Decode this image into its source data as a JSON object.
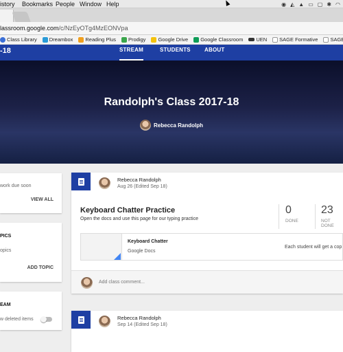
{
  "menubar": {
    "items": [
      "istory",
      "Bookmarks",
      "People",
      "Window",
      "Help"
    ]
  },
  "browser": {
    "url_host": "lassroom.google.com",
    "url_path": "/c/NzEyOTg4MzEONVpa"
  },
  "bookmarks": [
    {
      "label": "Class Library",
      "color": "#3b6fd6"
    },
    {
      "label": "Dreambox",
      "color": "#2a9bd8"
    },
    {
      "label": "Reading Plus",
      "color": "#f0a020"
    },
    {
      "label": "Prodigy",
      "color": "#3aa64b"
    },
    {
      "label": "Google Drive",
      "color": "#f4c20d"
    },
    {
      "label": "Google Classroom",
      "color": "#0f9d58"
    },
    {
      "label": "UEN",
      "color": "#333333"
    },
    {
      "label": "SAGE Formative",
      "color": "#999999"
    },
    {
      "label": "SAGE Su",
      "color": "#999999"
    }
  ],
  "classnav": {
    "class_abbrev": "-18",
    "tabs": [
      {
        "label": "STREAM",
        "active": true
      },
      {
        "label": "STUDENTS",
        "active": false
      },
      {
        "label": "ABOUT",
        "active": false
      }
    ]
  },
  "banner": {
    "title": "Randolph's Class 2017-18",
    "teacher": "Rebecca Randolph"
  },
  "left": {
    "upcoming_text": "work due soon",
    "view_all": "VIEW ALL",
    "topics_heading": "PICS",
    "topics_text": "opics",
    "add_topic": "ADD TOPIC",
    "stream_heading": "EAM",
    "show_deleted": "w deleted items"
  },
  "posts": [
    {
      "author": "Rebecca Randolph",
      "date": "Aug 26 (Edited Sep 18)",
      "title": "Keyboard Chatter Practice",
      "description": "Open the docs and use this page for our typing practice",
      "done_count": "0",
      "done_label": "DONE",
      "not_done_count": "23",
      "not_done_label": "NOT DONE",
      "attachment_title": "Keyboard Chatter",
      "attachment_type": "Google Docs",
      "attachment_note": "Each student will get a cop",
      "comment_placeholder": "Add class comment..."
    },
    {
      "author": "Rebecca Randolph",
      "date": "Sep 14 (Edited Sep 18)"
    }
  ],
  "colors": {
    "brand": "#1e3fa3",
    "card": "#ffffff",
    "page_bg": "#eeeeee"
  }
}
